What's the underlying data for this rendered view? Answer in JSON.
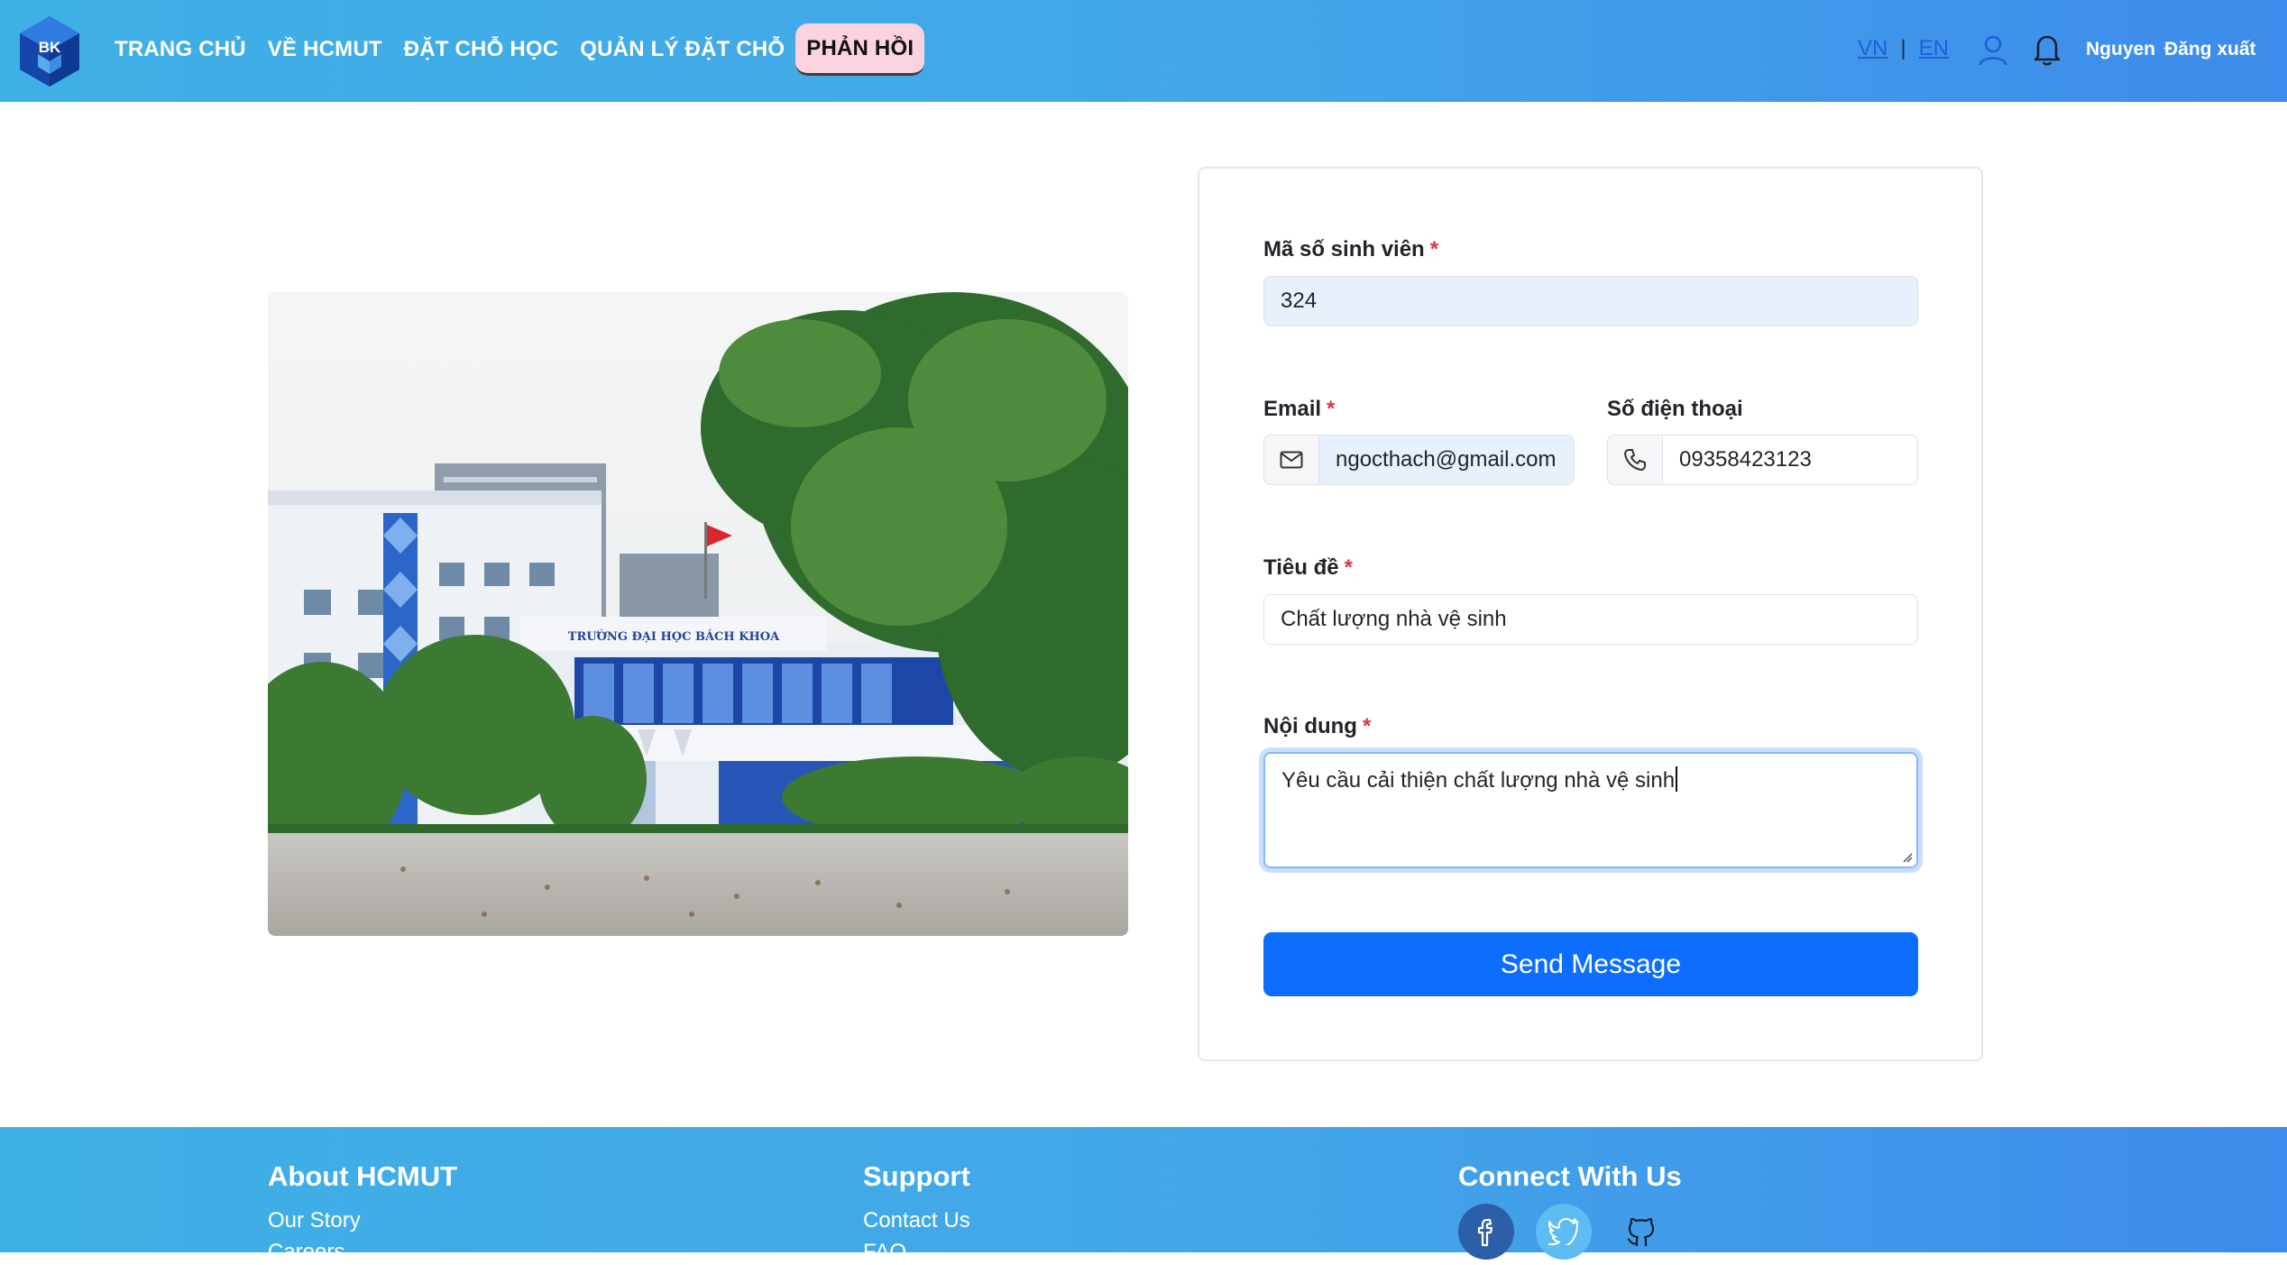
{
  "header": {
    "logo_text": "BK",
    "nav": [
      {
        "label": "TRANG CHỦ"
      },
      {
        "label": "VỀ HCMUT"
      },
      {
        "label": "ĐẶT CHỖ HỌC"
      },
      {
        "label": "QUẢN LÝ ĐẶT CHỖ"
      },
      {
        "label": "PHẢN HỒI",
        "active": true
      }
    ],
    "lang_vn": "VN",
    "lang_sep": "|",
    "lang_en": "EN",
    "username": "Nguyen",
    "logout": "Đăng xuất"
  },
  "photo": {
    "building_sign": "TRƯỜNG ĐẠI HỌC BÁCH KHOA"
  },
  "form": {
    "student_id_label": "Mã số sinh viên",
    "student_id_value": "324",
    "email_label": "Email",
    "email_value": "ngocthach@gmail.com",
    "phone_label": "Số điện thoại",
    "phone_value": "09358423123",
    "title_label": "Tiêu đề",
    "title_value": "Chất lượng nhà vệ sinh",
    "content_label": "Nội dung",
    "content_value": "Yêu cầu cải thiện chất lượng nhà vệ sinh",
    "required_mark": "*",
    "submit_label": "Send Message"
  },
  "footer": {
    "about_heading": "About HCMUT",
    "about_links": [
      "Our Story",
      "Careers"
    ],
    "support_heading": "Support",
    "support_links": [
      "Contact Us",
      "FAQ"
    ],
    "connect_heading": "Connect With Us",
    "social_icons": [
      "facebook-icon",
      "twitter-icon",
      "github-icon"
    ]
  },
  "colors": {
    "header_gradient": [
      "#3fb0e6",
      "#3d8bea"
    ],
    "active_tab": "#fbd3de",
    "primary_button": "#0d6efd",
    "required": "#dc3545",
    "autofill_bg": "#e8f0fe"
  }
}
